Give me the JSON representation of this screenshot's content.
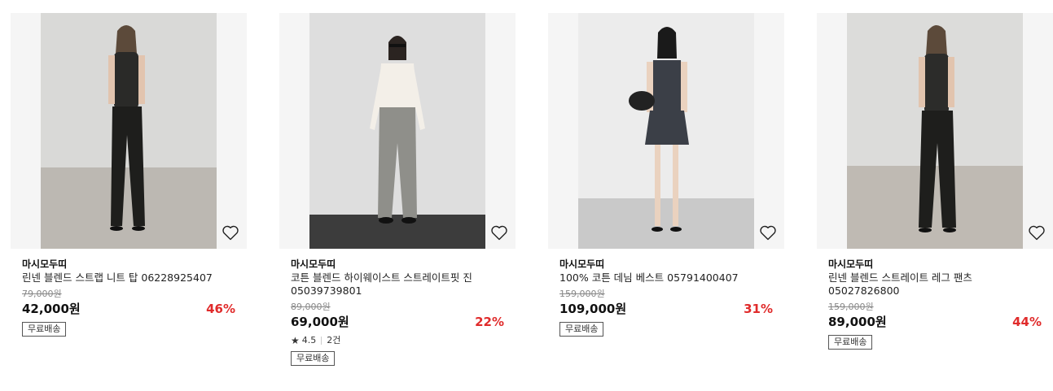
{
  "products": [
    {
      "brand": "마시모두띠",
      "name": "린넨 블렌드 스트랩 니트 탑 06228925407",
      "original_price": "79,000원",
      "price": "42,000원",
      "discount": "46%",
      "shipping_badge": "무료배송",
      "image_alt": "model-in-black-linen-top-and-trousers"
    },
    {
      "brand": "마시모두띠",
      "name": "코튼 블렌드 하이웨이스트 스트레이트핏 진 05039739801",
      "original_price": "89,000원",
      "price": "69,000원",
      "discount": "22%",
      "rating": "4.5",
      "review_count": "2건",
      "shipping_badge": "무료배송",
      "image_alt": "model-in-white-knit-and-grey-jeans"
    },
    {
      "brand": "마시모두띠",
      "name": "100% 코튼 데님 베스트 05791400407",
      "original_price": "159,000원",
      "price": "109,000원",
      "discount": "31%",
      "shipping_badge": "무료배송",
      "image_alt": "model-in-denim-vest-and-skirt"
    },
    {
      "brand": "마시모두띠",
      "name": "린넨 블렌드 스트레이트 레그 팬츠 05027826800",
      "original_price": "159,000원",
      "price": "89,000원",
      "discount": "44%",
      "shipping_badge": "무료배송",
      "image_alt": "model-in-black-linen-straight-pants"
    }
  ],
  "colors": {
    "discount": "#e02b2b",
    "thumb_background": "#f5f5f5"
  },
  "icons": {
    "wishlist": "heart-outline-icon",
    "rating": "star-icon"
  }
}
